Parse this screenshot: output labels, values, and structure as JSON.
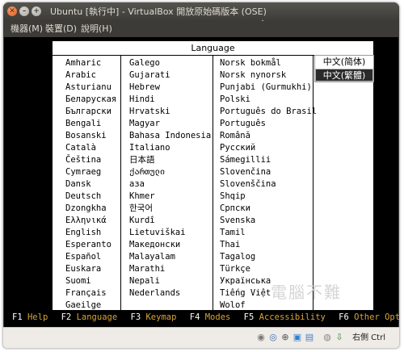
{
  "window": {
    "title": "Ubuntu [執行中] - VirtualBox 開放原始碼版本 (OSE)"
  },
  "menubar": {
    "items": [
      {
        "label": "機器(M)"
      },
      {
        "label": "裝置(D)"
      },
      {
        "label": "說明(H)"
      }
    ]
  },
  "language_panel": {
    "title": "Language",
    "columns": [
      [
        "Amharic",
        "Arabic",
        "Asturianu",
        "Беларуская",
        "Български",
        "Bengali",
        "Bosanski",
        "Català",
        "Čeština",
        "Cymraeg",
        "Dansk",
        "Deutsch",
        "Dzongkha",
        "Ελληνικά",
        "English",
        "Esperanto",
        "Español",
        "Euskara",
        "Suomi",
        "Français",
        "Gaeilge"
      ],
      [
        "Galego",
        "Gujarati",
        "Hebrew",
        "Hindi",
        "Hrvatski",
        "Magyar",
        "Bahasa Indonesia",
        "Italiano",
        "日本語",
        "ქართული",
        "аза",
        "Khmer",
        "한국어",
        "Kurdî",
        "Lietuviškai",
        "Македонски",
        "Malayalam",
        "Marathi",
        "Nepali",
        "Nederlands"
      ],
      [
        "Norsk bokmål",
        "Norsk nynorsk",
        "Punjabi (Gurmukhi)",
        "Polski",
        "Português do Brasil",
        "Português",
        "Română",
        "Русский",
        "Sámegillii",
        "Slovenčina",
        "Slovenščina",
        "Shqip",
        "Српски",
        "Svenska",
        "Tamil",
        "Thai",
        "Tagalog",
        "Türkçe",
        "Українська",
        "Tiếng Việt",
        "Wolof"
      ]
    ],
    "side_options": [
      {
        "label": "中文(简体)",
        "selected": false
      },
      {
        "label": "中文(繁體)",
        "selected": true
      }
    ]
  },
  "function_keys": [
    {
      "key": "F1",
      "label": "Help"
    },
    {
      "key": "F2",
      "label": "Language"
    },
    {
      "key": "F3",
      "label": "Keymap"
    },
    {
      "key": "F4",
      "label": "Modes"
    },
    {
      "key": "F5",
      "label": "Accessibility"
    },
    {
      "key": "F6",
      "label": "Other Options"
    }
  ],
  "status": {
    "host_key_label": "右側 Ctrl"
  },
  "watermark": "電腦不難",
  "colors": {
    "fkey_label": "#d7a437",
    "titlebar": "#3c3b37",
    "statusbar": "#efebe7"
  }
}
